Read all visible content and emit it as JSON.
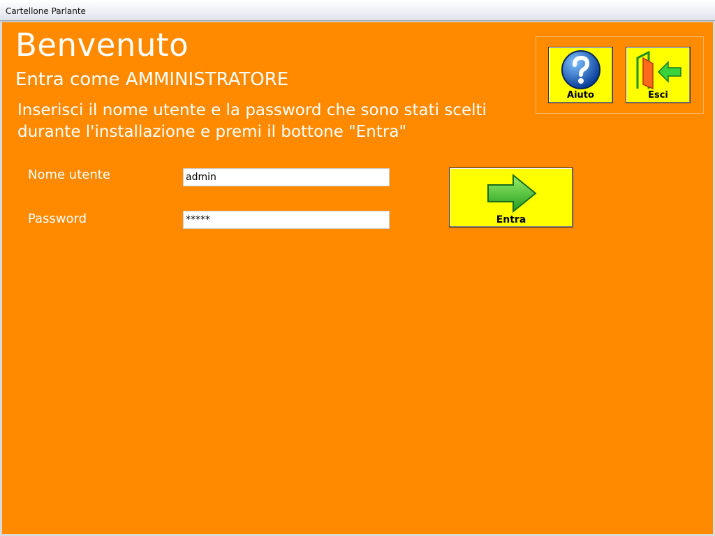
{
  "window": {
    "title": "Cartellone Parlante"
  },
  "header": {
    "welcome": "Benvenuto",
    "subtitle": "Entra come AMMINISTRATORE",
    "instructions_line1": "Inserisci il nome utente e la password che sono stati scelti",
    "instructions_line2": "durante l'installazione e premi il bottone \"Entra\""
  },
  "form": {
    "username_label": "Nome utente",
    "username_value": "admin",
    "password_label": "Password",
    "password_value": "*****"
  },
  "toolbar": {
    "help_label": "Aiuto",
    "exit_label": "Esci"
  },
  "actions": {
    "enter_label": "Entra"
  },
  "colors": {
    "background": "#ff8a00",
    "button": "#ffff00",
    "text": "#ffffff"
  }
}
